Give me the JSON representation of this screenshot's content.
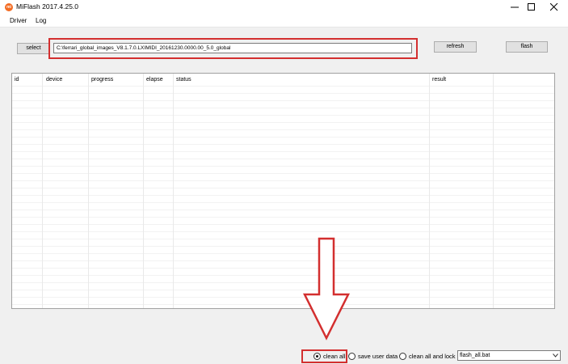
{
  "window": {
    "title": "MiFlash 2017.4.25.0",
    "app_icon": "mi-logo-icon",
    "app_icon_text": "mi",
    "controls": [
      "minimize-icon",
      "maximize-icon",
      "close-icon"
    ]
  },
  "menu": {
    "items": [
      "Driver",
      "Log"
    ]
  },
  "toolbar": {
    "select_label": "select",
    "path_value": "C:\\ferrari_global_images_V8.1.7.0.LXIMIDI_20161230.0000.00_5.0_global",
    "refresh_label": "refresh",
    "flash_label": "flash"
  },
  "table": {
    "columns": [
      "id",
      "device",
      "progress",
      "elapse",
      "status",
      "result"
    ],
    "rows": []
  },
  "options": {
    "radios": [
      {
        "label": "clean all",
        "selected": true
      },
      {
        "label": "save user data",
        "selected": false
      },
      {
        "label": "clean all and lock",
        "selected": false
      }
    ],
    "script_selected": "flash_all.bat"
  },
  "annotations": {
    "highlight_color": "#d32f2f",
    "arrow_icon": "down-arrow-icon"
  },
  "colors": {
    "accent": "#f36b22",
    "panel": "#f0f0f0",
    "highlight": "#d32f2f"
  }
}
